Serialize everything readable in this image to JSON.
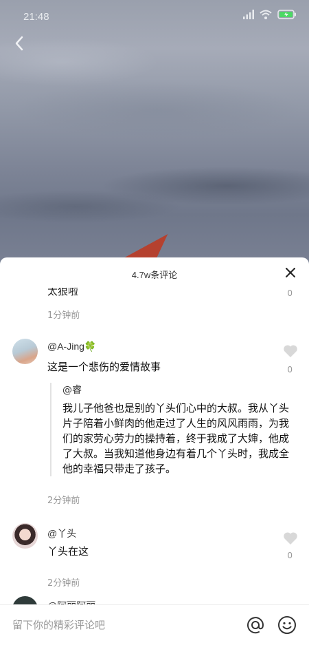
{
  "status_bar": {
    "time": "21:48",
    "icons": [
      "signal-icon",
      "wifi-icon",
      "battery-charging-icon"
    ]
  },
  "header": {
    "back_icon": "chevron-left-icon"
  },
  "comments_panel": {
    "title": "4.7w条评论",
    "close_icon": "close-icon"
  },
  "comments": [
    {
      "partial": true,
      "text": "太狠啦",
      "like_count": "0",
      "time": "1分钟前"
    },
    {
      "username": "@A-Jing🍀",
      "text": "这是一个悲伤的爱情故事",
      "like_count": "0",
      "quote": {
        "author": "@睿",
        "text": "我儿子他爸也是别的丫头们心中的大叔。我从丫头片子陪着小鲜肉的他走过了人生的风风雨雨，为我们的家劳心劳力的操持着，终于我成了大婶，他成了大叔。当我知道他身边有着几个丫头时，我成全他的幸福只带走了孩子。"
      },
      "time": "2分钟前"
    },
    {
      "username": "@丫头",
      "text": "丫头在这",
      "like_count": "0",
      "time": "2分钟前"
    },
    {
      "partial": true,
      "username": "@阿丽阿丽"
    }
  ],
  "input_bar": {
    "placeholder": "留下你的精彩评论吧",
    "value": "",
    "at_icon": "at-icon",
    "emoji_icon": "emoji-icon"
  },
  "colors": {
    "like_heart": "#d8d8d8",
    "muted_text": "#999999"
  }
}
